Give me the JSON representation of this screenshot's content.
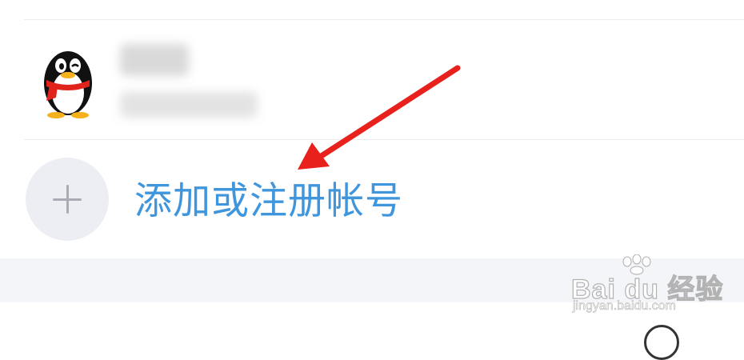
{
  "account_list": {
    "accounts": [
      {
        "avatar_icon": "qq-penguin-icon",
        "name": "",
        "id": ""
      }
    ],
    "add_account": {
      "icon": "plus-icon",
      "label": "添加或注册帐号"
    }
  },
  "colors": {
    "link_blue": "#3f96dd",
    "annotation_red": "#e8211d",
    "section_gray": "#f3f5f9"
  },
  "watermark": {
    "main": "Bai du 经验",
    "url": "jingyan.baidu.com"
  }
}
